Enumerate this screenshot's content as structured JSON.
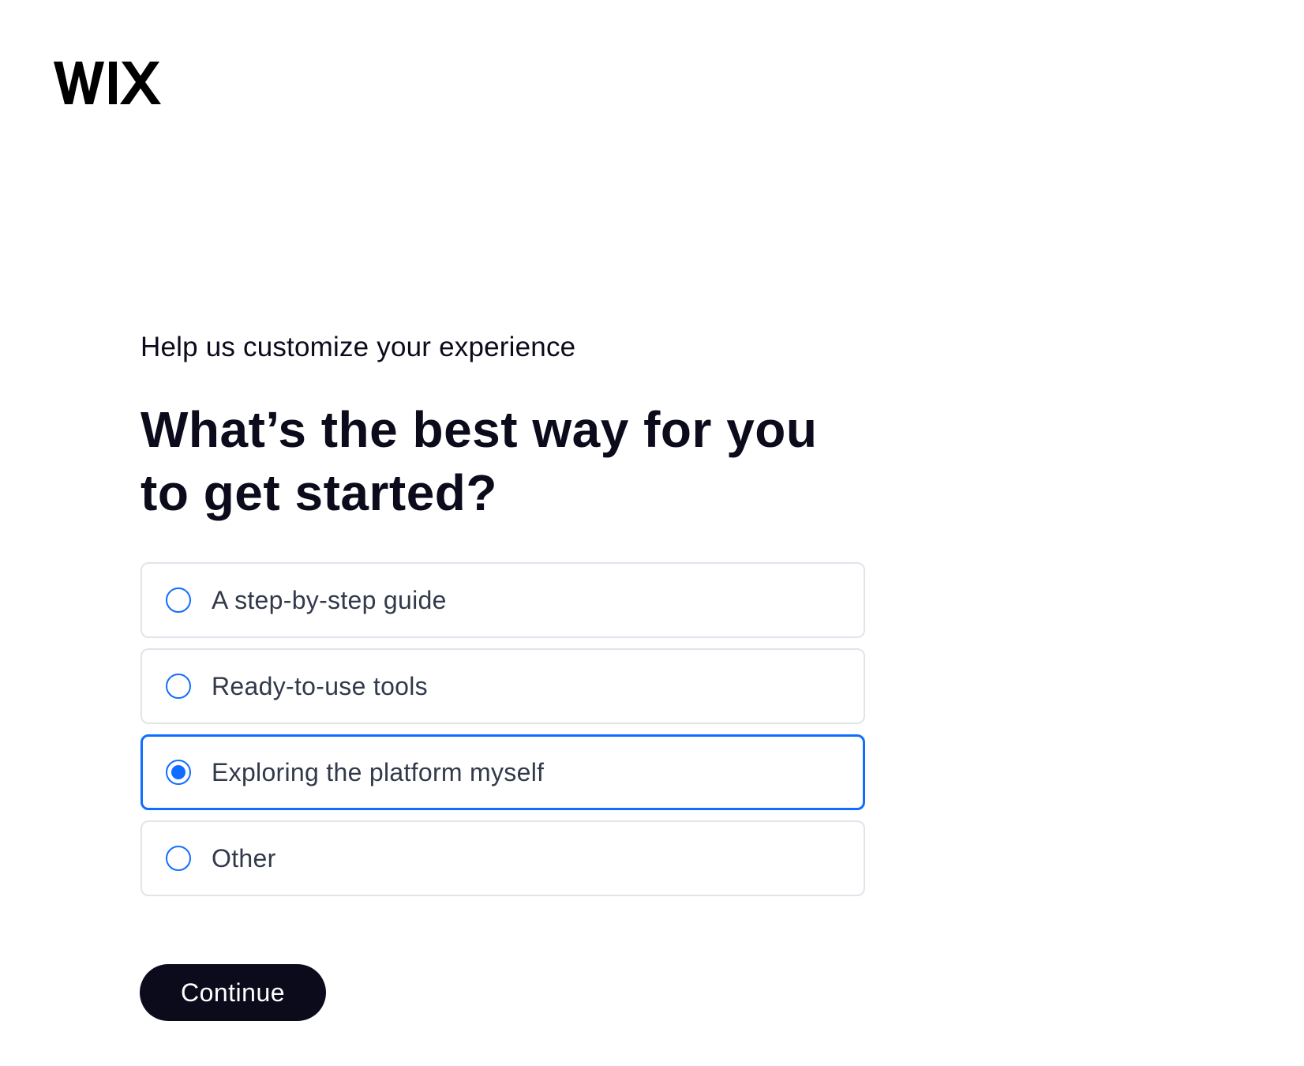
{
  "brand": {
    "logo_text": "WIX",
    "logo_color": "#000000"
  },
  "subtitle": "Help us customize your experience",
  "heading": "What’s the best way for you to get started?",
  "options": [
    {
      "label": "A step-by-step guide",
      "selected": false
    },
    {
      "label": "Ready-to-use tools",
      "selected": false
    },
    {
      "label": "Exploring the platform myself",
      "selected": true
    },
    {
      "label": "Other",
      "selected": false
    }
  ],
  "continue_label": "Continue",
  "colors": {
    "accent": "#116dff",
    "text_dark": "#0b0b1c",
    "option_text": "#32394a",
    "option_border": "#dfe5eb",
    "button_bg": "#0b0b1c"
  }
}
